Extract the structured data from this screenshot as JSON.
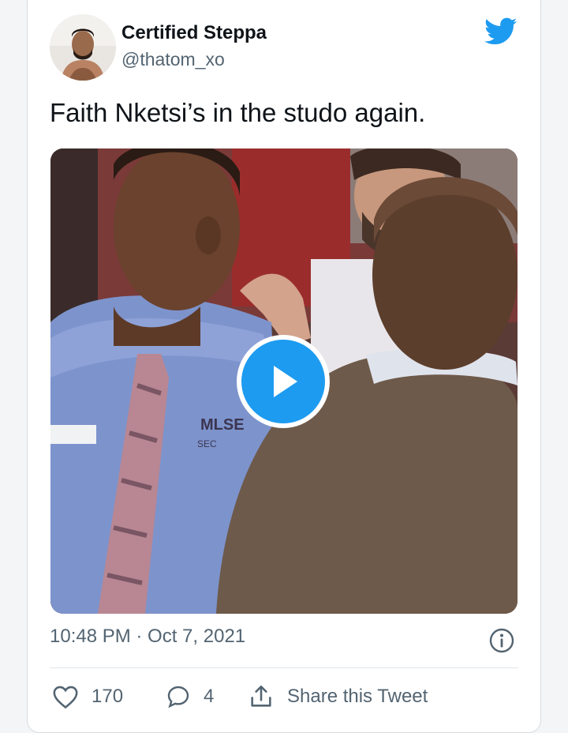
{
  "tweet": {
    "author": {
      "display_name": "Certified Steppa",
      "handle": "@thatom_xo"
    },
    "text": "Faith Nketsi’s in the studo again.",
    "media": {
      "type": "video",
      "badge_line1": "MLSE",
      "badge_line2": "SEC"
    },
    "timestamp": "10:48 PM · Oct 7, 2021",
    "actions": {
      "likes": "170",
      "replies": "4",
      "share_label": "Share this Tweet"
    }
  },
  "colors": {
    "accent": "#1d9bf0",
    "text_primary": "#0f1419",
    "text_secondary": "#536471"
  },
  "icons": [
    "twitter-bird-icon",
    "play-icon",
    "info-icon",
    "heart-icon",
    "reply-bubble-icon",
    "share-icon"
  ]
}
